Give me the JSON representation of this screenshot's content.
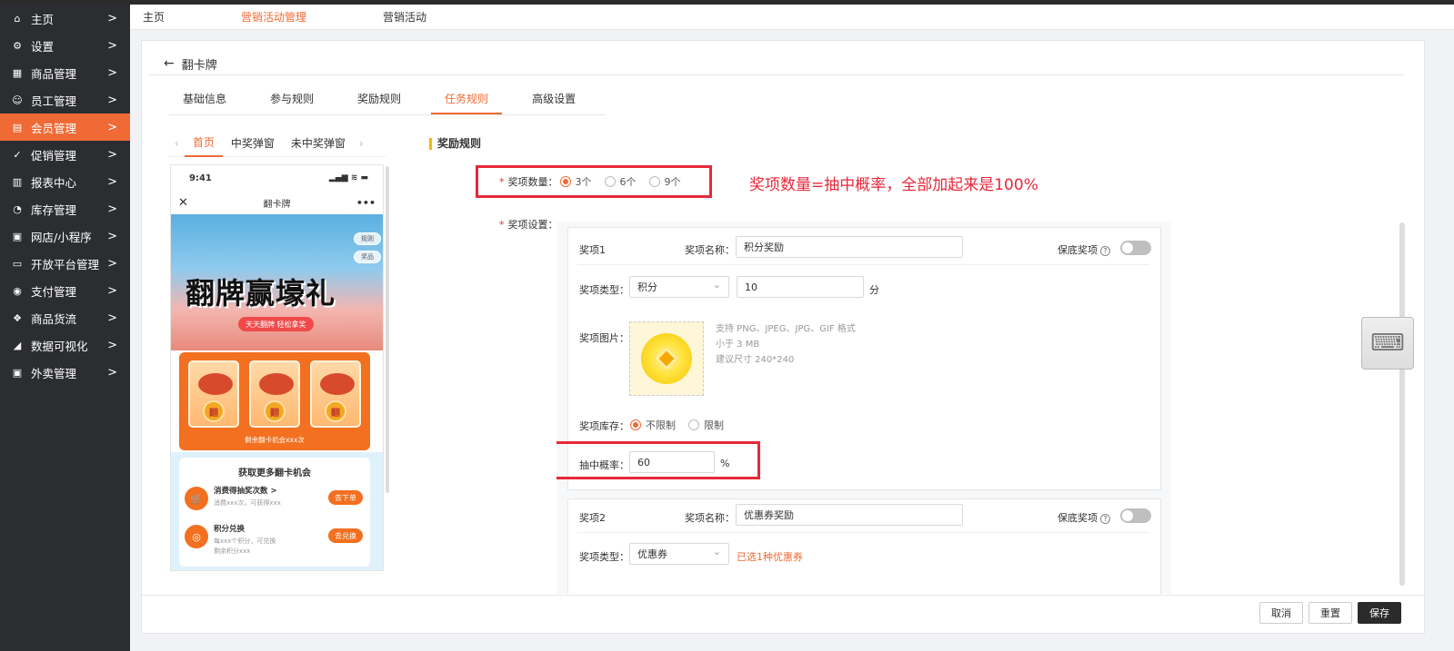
{
  "sidebar": {
    "items": [
      {
        "label": "主页",
        "icon": "⌂"
      },
      {
        "label": "设置",
        "icon": "⚙"
      },
      {
        "label": "商品管理",
        "icon": "▦"
      },
      {
        "label": "员工管理",
        "icon": "☺"
      },
      {
        "label": "会员管理",
        "icon": "▤"
      },
      {
        "label": "促销管理",
        "icon": "✓"
      },
      {
        "label": "报表中心",
        "icon": "▥"
      },
      {
        "label": "库存管理",
        "icon": "◔"
      },
      {
        "label": "网店/小程序",
        "icon": "▣"
      },
      {
        "label": "开放平台管理",
        "icon": "▭"
      },
      {
        "label": "支付管理",
        "icon": "◉"
      },
      {
        "label": "商品货流",
        "icon": "❖"
      },
      {
        "label": "数据可视化",
        "icon": "◢"
      },
      {
        "label": "外卖管理",
        "icon": "▣"
      }
    ],
    "arrow": ">",
    "active_index": 4
  },
  "tabs": [
    "主页",
    "营销活动管理",
    "营销活动"
  ],
  "page": {
    "back_arrow": "←",
    "title": "翻卡牌"
  },
  "steps": [
    "基础信息",
    "参与规则",
    "奖励规则",
    "任务规则",
    "高级设置"
  ],
  "preview": {
    "arrow_left": "‹",
    "arrow_right": "›",
    "tabs": [
      "首页",
      "中奖弹窗",
      "未中奖弹窗"
    ],
    "time": "9:41",
    "signal": "▂▄▆ ≋ ▬",
    "close": "✕",
    "title": "翻卡牌",
    "more": "•••",
    "rule_btn": "规则",
    "prize_btn": "奖品",
    "headline": "翻牌赢壕礼",
    "pill": "天天翻牌 轻松拿奖",
    "card_char": "翻",
    "remaining": "剩余翻卡机会xxx次",
    "more_title": "获取更多翻卡机会",
    "task1_icon": "🛒",
    "task1_title": "消费得抽奖次数 >",
    "task1_desc": "消费xxx次，可获得xxx",
    "task1_btn": "去下单",
    "task2_icon": "◎",
    "task2_title": "积分兑换",
    "task2_desc1": "每xxx个积分，可兑换",
    "task2_desc2": "剩余积分xxx",
    "task2_btn": "去兑换"
  },
  "form": {
    "section_title": "奖励规则",
    "count_label": "奖项数量",
    "count_options": [
      "3个",
      "6个",
      "9个"
    ],
    "count_selected": "3个",
    "annotation": "奖项数量=抽中概率，全部加起来是100%",
    "settings_label": "奖项设置",
    "required_mark": "*",
    "colon": "："
  },
  "prize1": {
    "label": "奖项1",
    "name_label": "奖项名称：",
    "name_value": "积分奖励",
    "guarantee_label": "保底奖项",
    "help": "?",
    "type_label": "奖项类型：",
    "type_value": "积分",
    "points_value": "10",
    "points_unit": "分",
    "image_label": "奖项图片：",
    "image_hints": [
      "支持 PNG、JPEG、JPG、GIF 格式",
      "小于 3 MB",
      "建议尺寸 240*240"
    ],
    "stock_label": "奖项库存：",
    "stock_options": [
      "不限制",
      "限制"
    ],
    "stock_selected": "不限制",
    "prob_label": "抽中概率：",
    "prob_value": "60",
    "prob_unit": "%"
  },
  "prize2": {
    "label": "奖项2",
    "name_label": "奖项名称：",
    "name_value": "优惠券奖励",
    "guarantee_label": "保底奖项",
    "help": "?",
    "type_label": "奖项类型：",
    "type_value": "优惠券",
    "coupon_note": "已选1种优惠券"
  },
  "footer": {
    "cancel": "取消",
    "reset": "重置",
    "save": "保存"
  },
  "keyboard_icon": "⌨",
  "colors": {
    "accent": "#f06a35",
    "annotation": "#e8283a",
    "sidebar": "#2b2d30"
  }
}
